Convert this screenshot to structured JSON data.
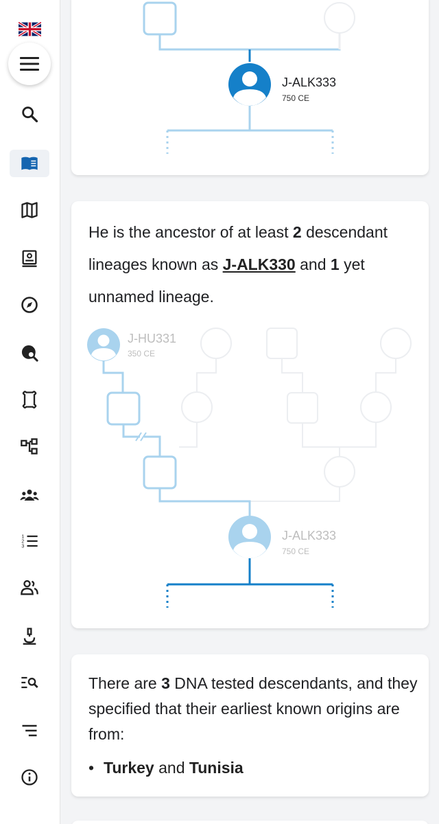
{
  "sidebar": {
    "language": "English (UK)",
    "items": [
      {
        "icon": "search-icon"
      },
      {
        "icon": "book-icon",
        "active": true
      },
      {
        "icon": "map-icon"
      },
      {
        "icon": "certificate-icon"
      },
      {
        "icon": "compass-icon"
      },
      {
        "icon": "globe-search-icon"
      },
      {
        "icon": "bone-icon"
      },
      {
        "icon": "tree-structure-icon"
      },
      {
        "icon": "groups-icon"
      },
      {
        "icon": "numbered-list-icon"
      },
      {
        "icon": "people-icon"
      },
      {
        "icon": "microscope-icon"
      },
      {
        "icon": "list-search-icon"
      },
      {
        "icon": "sort-lines-icon"
      },
      {
        "icon": "info-icon"
      }
    ]
  },
  "card1": {
    "node_name": "J-ALK333",
    "node_date": "750 CE"
  },
  "card2": {
    "text_a": "He is the ancestor of at least ",
    "count_a": "2",
    "text_b": " descendant lineages known as ",
    "link": "J-ALK330",
    "text_c": " and ",
    "count_b": "1",
    "text_d": " yet unnamed lineage.",
    "ancestor_name": "J-HU331",
    "ancestor_date": "350 CE",
    "node_name": "J-ALK333",
    "node_date": "750 CE"
  },
  "card3": {
    "text_a": "There are ",
    "count": "3",
    "text_b": " DNA tested descendants, and they specified that their earliest known origins are from:",
    "country1": "Turkey",
    "conj": " and ",
    "country2": "Tunisia"
  },
  "colors": {
    "primary": "#1580c9",
    "light": "#a9d3ee",
    "faint": "#eceef1"
  }
}
